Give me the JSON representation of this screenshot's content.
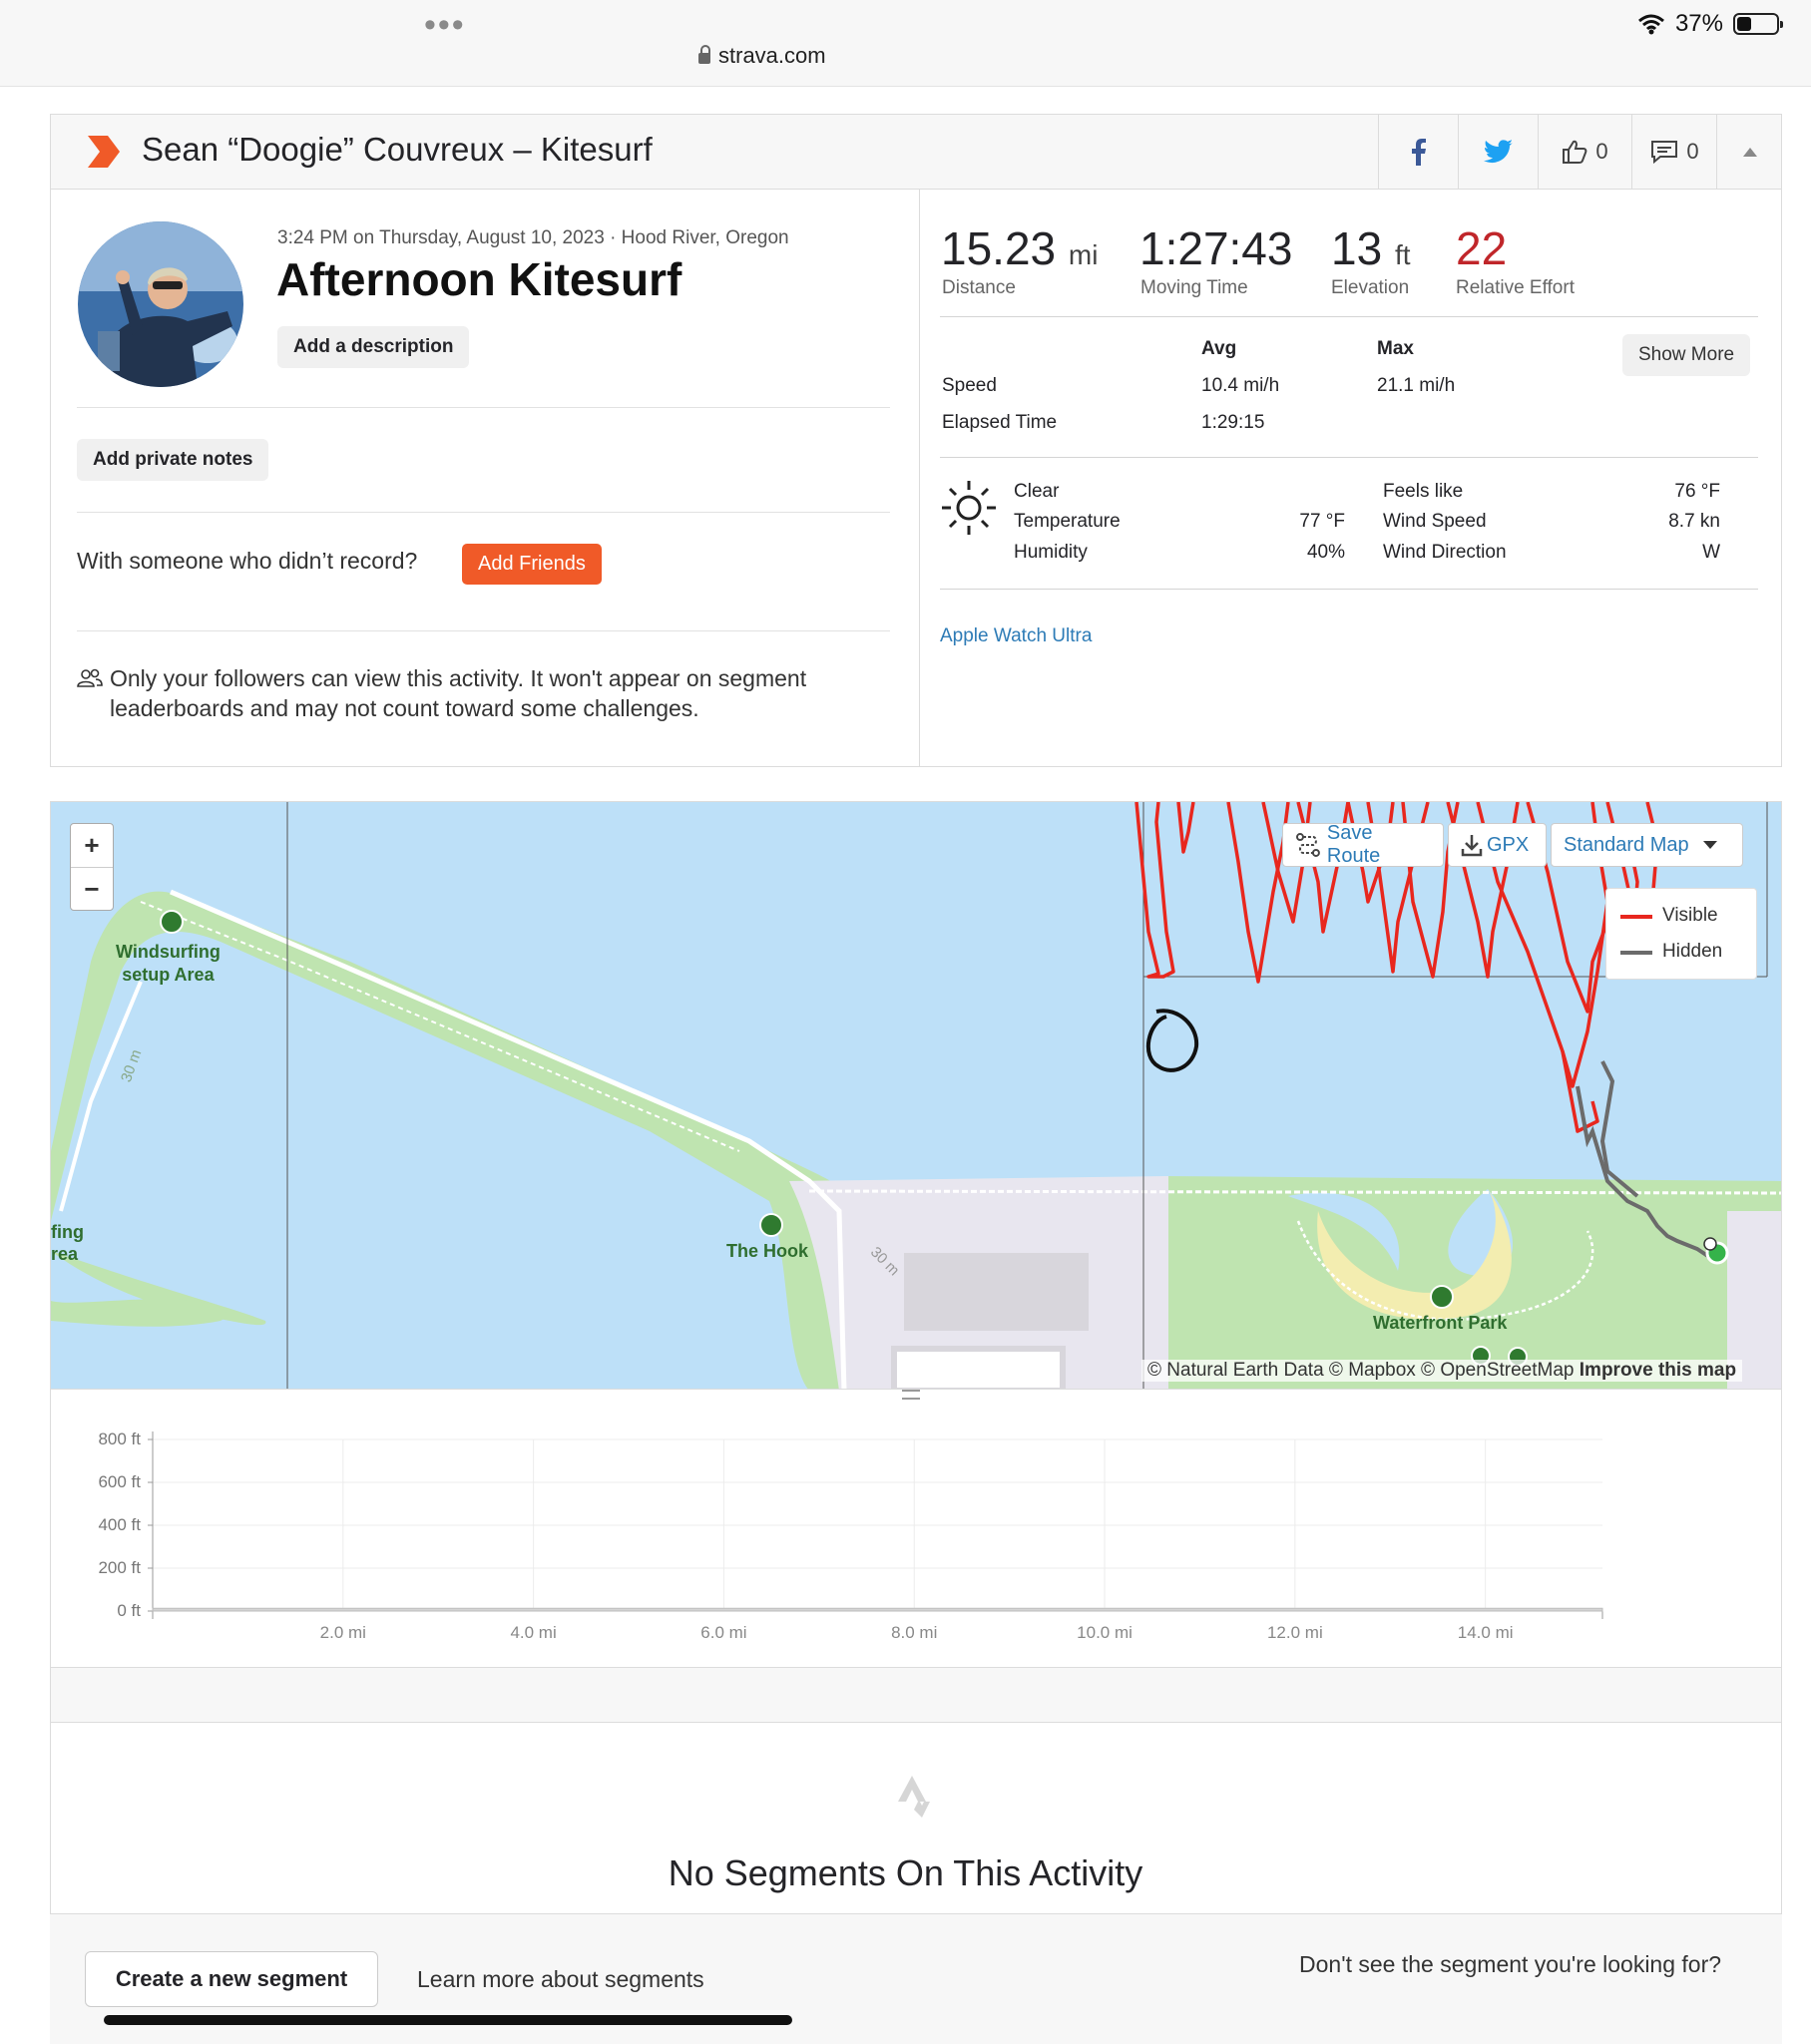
{
  "browser": {
    "url": "strava.com",
    "battery": "37%"
  },
  "header": {
    "title": "Sean “Doogie” Couvreux – Kitesurf",
    "kudos_count": "0",
    "comments_count": "0"
  },
  "activity": {
    "datetime": "3:24 PM on Thursday, August 10, 2023 · Hood River, Oregon",
    "title": "Afternoon Kitesurf",
    "add_description": "Add a description",
    "add_private_notes": "Add private notes",
    "with_someone": "With someone who didn’t record?",
    "add_friends": "Add Friends",
    "privacy_notice": "Only your followers can view this activity. It won't appear on segment leaderboards and may not count toward some challenges."
  },
  "stats": {
    "distance": {
      "value": "15.23",
      "unit": "mi",
      "label": "Distance"
    },
    "moving_time": {
      "value": "1:27:43",
      "label": "Moving Time"
    },
    "elevation": {
      "value": "13",
      "unit": "ft",
      "label": "Elevation"
    },
    "relative_effort": {
      "value": "22",
      "label": "Relative Effort"
    },
    "table": {
      "col_avg": "Avg",
      "col_max": "Max",
      "speed_label": "Speed",
      "speed_avg": "10.4 mi/h",
      "speed_max": "21.1 mi/h",
      "elapsed_label": "Elapsed Time",
      "elapsed_value": "1:29:15"
    },
    "show_more": "Show More",
    "weather": {
      "condition": "Clear",
      "temperature_label": "Temperature",
      "temperature": "77 °F",
      "humidity_label": "Humidity",
      "humidity": "40%",
      "feels_like_label": "Feels like",
      "feels_like": "76 °F",
      "wind_speed_label": "Wind Speed",
      "wind_speed": "8.7 kn",
      "wind_direction_label": "Wind Direction",
      "wind_direction": "W"
    },
    "device": "Apple Watch Ultra"
  },
  "map": {
    "save_route": "Save Route",
    "gpx": "GPX",
    "map_style": "Standard Map",
    "legend_visible": "Visible",
    "legend_hidden": "Hidden",
    "labels": {
      "windsurfing_1": "Windsurfing",
      "windsurfing_2": "setup Area",
      "hook": "The Hook",
      "waterfront": "Waterfront Park",
      "partial_1": "fing",
      "partial_2": "rea",
      "contour_a": "30 m",
      "contour_b": "30 m"
    },
    "attribution": "© Natural Earth Data © Mapbox © OpenStreetMap",
    "improve": "Improve this map",
    "colors": {
      "visible": "#e8271e",
      "hidden": "#6b6b6b",
      "water": "#bde0f8",
      "park": "#bfe4b0"
    }
  },
  "chart_data": {
    "type": "area",
    "y_ticks": [
      "800 ft",
      "600 ft",
      "400 ft",
      "200 ft",
      "0 ft"
    ],
    "x_ticks": [
      "2.0 mi",
      "4.0 mi",
      "6.0 mi",
      "8.0 mi",
      "10.0 mi",
      "12.0 mi",
      "14.0 mi"
    ],
    "ylim": [
      0,
      800
    ],
    "xlim": [
      0,
      15.23
    ],
    "x": [
      0,
      15.23
    ],
    "y": [
      13,
      13
    ],
    "grid": true
  },
  "segments": {
    "no_segments": "No Segments On This Activity",
    "create": "Create a new segment",
    "learn_more": "Learn more about segments",
    "dont_see": "Don't see the segment you're looking for?"
  }
}
